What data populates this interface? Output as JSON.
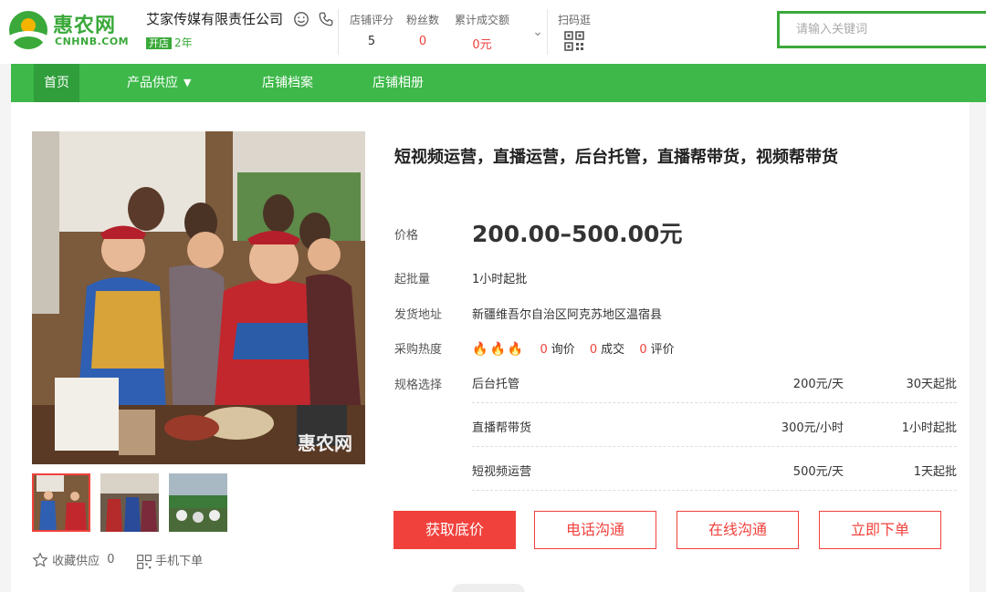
{
  "logo": {
    "name_cn": "惠农网",
    "name_en": "CNHNB.COM"
  },
  "company": {
    "name": "艾家传媒有限责任公司",
    "open_tag": "开店",
    "years": "2年"
  },
  "stats": [
    {
      "label": "店铺评分",
      "value": "5"
    },
    {
      "label": "粉丝数",
      "value": "0"
    },
    {
      "label": "累计成交额",
      "value": "0元"
    }
  ],
  "scan": {
    "label": "扫码逛"
  },
  "search": {
    "placeholder": "请输入关键词",
    "value": ""
  },
  "nav": {
    "items": [
      "首页",
      "产品供应",
      "店铺档案",
      "店铺相册"
    ]
  },
  "product": {
    "title": "短视频运营，直播运营，后台托管，直播帮带货，视频帮带货",
    "price_label": "价格",
    "price": "200.00–500.00元",
    "moq_label": "起批量",
    "moq": "1小时起批",
    "ship_label": "发货地址",
    "ship": "新疆维吾尔自治区阿克苏地区温宿县",
    "heat_label": "采购热度",
    "inquiries": "0",
    "inquiries_label": "询价",
    "deals": "0",
    "deals_label": "成交",
    "reviews": "0",
    "reviews_label": "评价",
    "spec_label": "规格选择",
    "specs": [
      {
        "name": "后台托管",
        "price": "200元/天",
        "moq": "30天起批"
      },
      {
        "name": "直播帮带货",
        "price": "300元/小时",
        "moq": "1小时起批"
      },
      {
        "name": "短视频运营",
        "price": "500元/天",
        "moq": "1天起批"
      }
    ]
  },
  "watermark": "惠农网",
  "fav": {
    "label": "收藏供应",
    "count": "0"
  },
  "mobile_order": "手机下单",
  "buttons": {
    "lowest_price": "获取底价",
    "phone": "电话沟通",
    "online": "在线沟通",
    "order": "立即下单"
  },
  "colors": {
    "brand_green": "#3db849",
    "accent_red": "#f0413c"
  },
  "icons": [
    "smile-icon",
    "phone-icon",
    "chevron-down-icon",
    "qr-code-icon",
    "fire-icon",
    "star-icon"
  ]
}
